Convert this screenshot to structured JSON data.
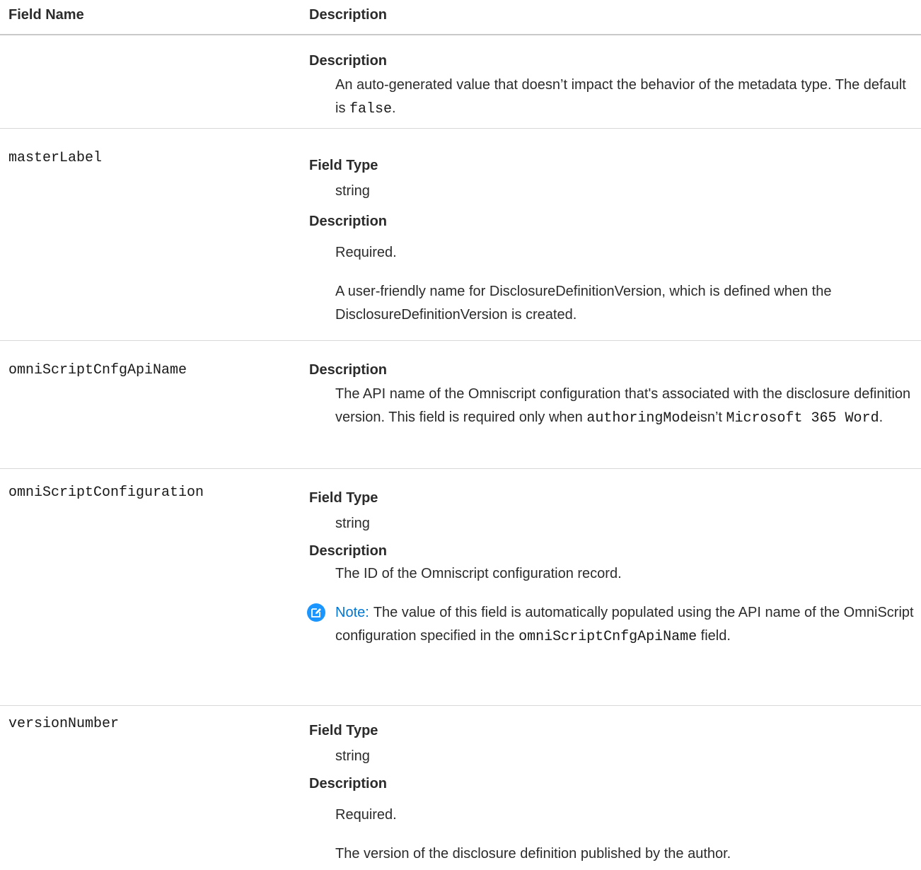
{
  "header": {
    "field_name": "Field Name",
    "description": "Description"
  },
  "rows": [
    {
      "desc_label": "Description",
      "desc_text_1": "An auto-generated value that doesn’t impact the behavior of the metadata type. The default is ",
      "desc_code_1": "false",
      "desc_text_2": "."
    },
    {
      "name": "masterLabel",
      "type_label": "Field Type",
      "type_value": "string",
      "desc_label": "Description",
      "desc_para_1": "Required.",
      "desc_para_2": "A user-friendly name for DisclosureDefinitionVersion, which is defined when the DisclosureDefinitionVersion is created."
    },
    {
      "name": "omniScriptCnfgApiName",
      "desc_label": "Description",
      "desc_text_1": "The API name of the Omniscript configuration that's associated with the disclosure definition version. This field is required only when ",
      "desc_code_1": "authoringMode",
      "desc_text_2": "isn’t ",
      "desc_code_2": "Microsoft 365 Word",
      "desc_text_3": "."
    },
    {
      "name": "omniScriptConfiguration",
      "type_label": "Field Type",
      "type_value": "string",
      "desc_label": "Description",
      "desc_para_1": "The ID of the Omniscript configuration record.",
      "note_label": "Note:",
      "note_text_1": "The value of this field is automatically populated using the API name of the OmniScript configuration specified in the ",
      "note_code": "omniScriptCnfgApiName",
      "note_text_2": " field."
    },
    {
      "name": "versionNumber",
      "type_label": "Field Type",
      "type_value": "string",
      "desc_label": "Description",
      "desc_para_1": "Required.",
      "desc_para_2": "The version of the disclosure definition published by the author."
    }
  ]
}
